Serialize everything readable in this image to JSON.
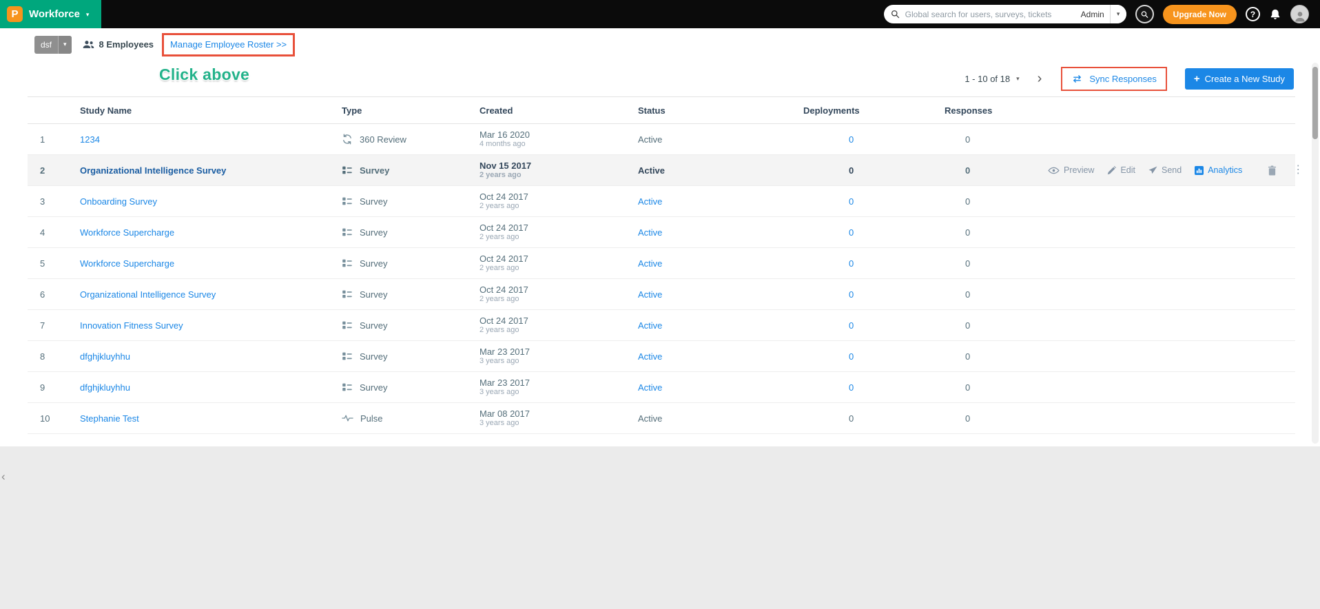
{
  "topbar": {
    "logo_letter": "P",
    "product": "Workforce",
    "search_placeholder": "Global search for users, surveys, tickets",
    "search_scope": "Admin",
    "upgrade": "Upgrade Now"
  },
  "subheader": {
    "team": "dsf",
    "employees": "8 Employees",
    "roster_link": "Manage Employee Roster >>",
    "annotation": "Click above"
  },
  "toolbar": {
    "pagination": "1 - 10 of 18",
    "sync": "Sync Responses",
    "create": "Create a New Study"
  },
  "table": {
    "headers": [
      "Study Name",
      "Type",
      "Created",
      "Status",
      "Deployments",
      "Responses"
    ],
    "rows": [
      {
        "num": "1",
        "name": "1234",
        "type": "360 Review",
        "type_icon": "review360",
        "created": "Mar 16 2020",
        "created_ago": "4 months ago",
        "status": "Active",
        "status_style": "plain",
        "deployments": "0",
        "deployments_style": "link",
        "responses": "0",
        "highlighted": false,
        "show_actions": false
      },
      {
        "num": "2",
        "name": "Organizational Intelligence Survey",
        "type": "Survey",
        "type_icon": "survey",
        "created": "Nov 15 2017",
        "created_ago": "2 years ago",
        "status": "Active",
        "status_style": "bold",
        "deployments": "0",
        "deployments_style": "bold",
        "responses": "0",
        "highlighted": true,
        "show_actions": true
      },
      {
        "num": "3",
        "name": "Onboarding Survey",
        "type": "Survey",
        "type_icon": "survey",
        "created": "Oct 24 2017",
        "created_ago": "2 years ago",
        "status": "Active",
        "status_style": "link",
        "deployments": "0",
        "deployments_style": "link",
        "responses": "0",
        "highlighted": false,
        "show_actions": false
      },
      {
        "num": "4",
        "name": "Workforce Supercharge",
        "type": "Survey",
        "type_icon": "survey",
        "created": "Oct 24 2017",
        "created_ago": "2 years ago",
        "status": "Active",
        "status_style": "link",
        "deployments": "0",
        "deployments_style": "link",
        "responses": "0",
        "highlighted": false,
        "show_actions": false
      },
      {
        "num": "5",
        "name": "Workforce Supercharge",
        "type": "Survey",
        "type_icon": "survey",
        "created": "Oct 24 2017",
        "created_ago": "2 years ago",
        "status": "Active",
        "status_style": "link",
        "deployments": "0",
        "deployments_style": "link",
        "responses": "0",
        "highlighted": false,
        "show_actions": false
      },
      {
        "num": "6",
        "name": "Organizational Intelligence Survey",
        "type": "Survey",
        "type_icon": "survey",
        "created": "Oct 24 2017",
        "created_ago": "2 years ago",
        "status": "Active",
        "status_style": "link",
        "deployments": "0",
        "deployments_style": "link",
        "responses": "0",
        "highlighted": false,
        "show_actions": false
      },
      {
        "num": "7",
        "name": "Innovation Fitness Survey",
        "type": "Survey",
        "type_icon": "survey",
        "created": "Oct 24 2017",
        "created_ago": "2 years ago",
        "status": "Active",
        "status_style": "link",
        "deployments": "0",
        "deployments_style": "link",
        "responses": "0",
        "highlighted": false,
        "show_actions": false
      },
      {
        "num": "8",
        "name": "dfghjkluyhhu",
        "type": "Survey",
        "type_icon": "survey",
        "created": "Mar 23 2017",
        "created_ago": "3 years ago",
        "status": "Active",
        "status_style": "link",
        "deployments": "0",
        "deployments_style": "link",
        "responses": "0",
        "highlighted": false,
        "show_actions": false
      },
      {
        "num": "9",
        "name": "dfghjkluyhhu",
        "type": "Survey",
        "type_icon": "survey",
        "created": "Mar 23 2017",
        "created_ago": "3 years ago",
        "status": "Active",
        "status_style": "link",
        "deployments": "0",
        "deployments_style": "link",
        "responses": "0",
        "highlighted": false,
        "show_actions": false
      },
      {
        "num": "10",
        "name": "Stephanie Test",
        "type": "Pulse",
        "type_icon": "pulse",
        "created": "Mar 08 2017",
        "created_ago": "3 years ago",
        "status": "Active",
        "status_style": "plain",
        "deployments": "0",
        "deployments_style": "plain",
        "responses": "0",
        "highlighted": false,
        "show_actions": false
      }
    ]
  },
  "actions": {
    "preview": "Preview",
    "edit": "Edit",
    "send": "Send",
    "analytics": "Analytics"
  },
  "icons": {
    "caret_down": "▾",
    "chevron_right": "›",
    "chevron_left": "‹",
    "help": "?",
    "plus": "+",
    "kebab": "⋮"
  },
  "colors": {
    "brand_teal": "#00A77D",
    "brand_orange": "#F7941D",
    "link_blue": "#1B87E6",
    "annotation_red": "#E8503A",
    "annotation_green": "#23B28A"
  }
}
